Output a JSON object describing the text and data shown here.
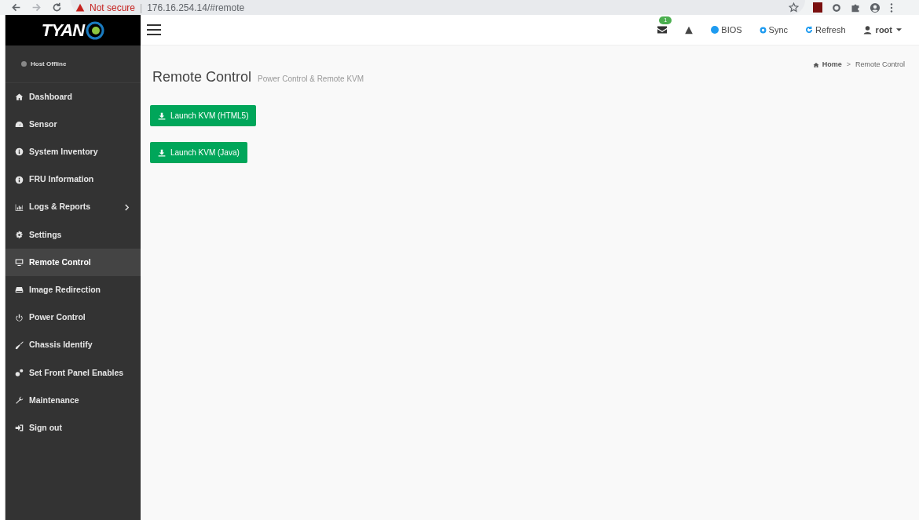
{
  "browser": {
    "security": "Not secure",
    "separator": "|",
    "url": "176.16.254.14/#remote"
  },
  "logo": "TYAN",
  "host_status": {
    "label": "Host Offline",
    "online": false
  },
  "sidebar": {
    "items": [
      {
        "label": "Dashboard",
        "selected": false,
        "has_submenu": false
      },
      {
        "label": "Sensor",
        "selected": false,
        "has_submenu": false
      },
      {
        "label": "System Inventory",
        "selected": false,
        "has_submenu": false
      },
      {
        "label": "FRU Information",
        "selected": false,
        "has_submenu": false
      },
      {
        "label": "Logs & Reports",
        "selected": false,
        "has_submenu": true
      },
      {
        "label": "Settings",
        "selected": false,
        "has_submenu": false
      },
      {
        "label": "Remote Control",
        "selected": true,
        "has_submenu": false
      },
      {
        "label": "Image Redirection",
        "selected": false,
        "has_submenu": false
      },
      {
        "label": "Power Control",
        "selected": false,
        "has_submenu": false
      },
      {
        "label": "Chassis Identify",
        "selected": false,
        "has_submenu": false
      },
      {
        "label": "Set Front Panel Enables",
        "selected": false,
        "has_submenu": false
      },
      {
        "label": "Maintenance",
        "selected": false,
        "has_submenu": false
      },
      {
        "label": "Sign out",
        "selected": false,
        "has_submenu": false
      }
    ]
  },
  "header": {
    "message_count": "1",
    "bios": "BIOS",
    "sync": "Sync",
    "refresh": "Refresh",
    "user": "root"
  },
  "breadcrumb": {
    "separator": ">",
    "items": [
      "Home",
      "Remote Control"
    ]
  },
  "page": {
    "title": "Remote Control",
    "subtitle": "Power Control & Remote KVM"
  },
  "buttons": [
    "Launch KVM (HTML5)",
    "Launch KVM (Java)"
  ]
}
